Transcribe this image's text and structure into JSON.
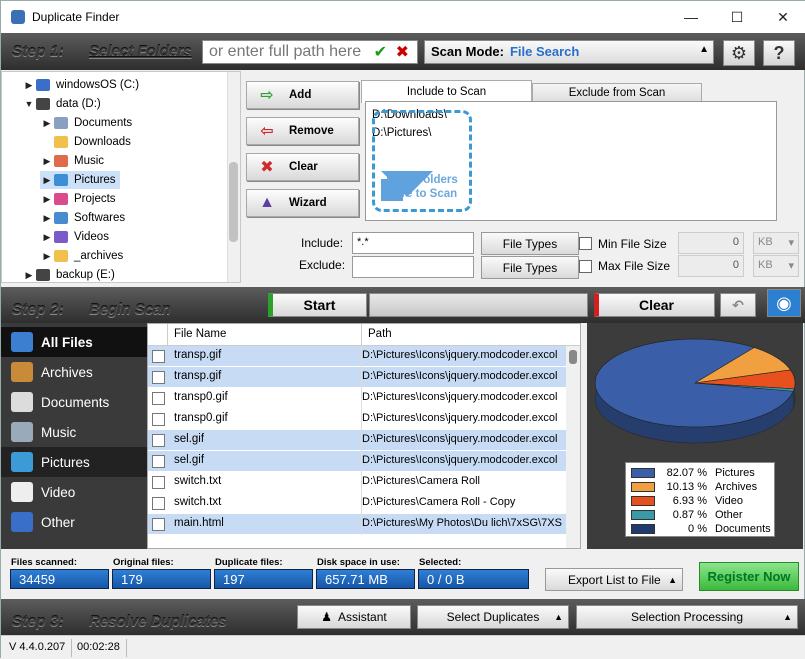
{
  "window": {
    "title": "Duplicate Finder",
    "minimize": "—",
    "maximize": "☐",
    "close": "✕"
  },
  "step1": {
    "label": "Step 1:",
    "sublabel": "Select Folders",
    "path_placeholder": "or enter full path here",
    "scan_mode_label": "Scan Mode:",
    "scan_mode_value": "File Search",
    "settings_icon": "gear-icon",
    "help_label": "?"
  },
  "tree": [
    {
      "label": "windowsOS (C:)",
      "expander": "▶",
      "icon": "drive-icon",
      "color": "#3a6fc9"
    },
    {
      "label": "data (D:)",
      "expander": "▼",
      "icon": "drive-icon",
      "color": "#444"
    },
    {
      "label": "Documents",
      "expander": "▶",
      "icon": "documents-folder-icon",
      "color": "#8aa0c0"
    },
    {
      "label": "Downloads",
      "expander": "",
      "icon": "folder-icon",
      "color": "#f1c04c"
    },
    {
      "label": "Music",
      "expander": "▶",
      "icon": "music-folder-icon",
      "color": "#e06b4a"
    },
    {
      "label": "Pictures",
      "expander": "▶",
      "icon": "pictures-folder-icon",
      "color": "#3c8fd6"
    },
    {
      "label": "Projects",
      "expander": "▶",
      "icon": "projects-folder-icon",
      "color": "#d94b8a"
    },
    {
      "label": "Softwares",
      "expander": "▶",
      "icon": "softwares-folder-icon",
      "color": "#4a8ad0"
    },
    {
      "label": "Videos",
      "expander": "▶",
      "icon": "videos-folder-icon",
      "color": "#7b5ac9"
    },
    {
      "label": "_archives",
      "expander": "▶",
      "icon": "folder-icon",
      "color": "#f1c04c"
    },
    {
      "label": "backup (E:)",
      "expander": "▶",
      "icon": "drive-icon",
      "color": "#444"
    }
  ],
  "actions": {
    "add": "Add",
    "remove": "Remove",
    "clear": "Clear",
    "wizard": "Wizard"
  },
  "tabs": {
    "include": "Include to Scan",
    "exclude": "Exclude from Scan"
  },
  "include_list": [
    "D:\\Downloads\\",
    "D:\\Pictures\\"
  ],
  "drop_area": {
    "line1": "Drop Folders",
    "line2": "Here to Scan"
  },
  "filters": {
    "include_label": "Include:",
    "include_value": "*.*",
    "exclude_label": "Exclude:",
    "exclude_value": "",
    "file_types": "File Types",
    "min_size_label": "Min File Size",
    "max_size_label": "Max File Size",
    "min_size_value": "0",
    "max_size_value": "0",
    "unit": "KB"
  },
  "step2": {
    "label": "Step 2:",
    "sublabel": "Begin Scan",
    "start": "Start",
    "clear": "Clear"
  },
  "categories": [
    {
      "label": "All Files",
      "icon": "all-files-icon",
      "color": "#3c7ed0"
    },
    {
      "label": "Archives",
      "icon": "archives-icon",
      "color": "#c98a3a"
    },
    {
      "label": "Documents",
      "icon": "documents-icon",
      "color": "#dcdcdc"
    },
    {
      "label": "Music",
      "icon": "music-icon",
      "color": "#9ab"
    },
    {
      "label": "Pictures",
      "icon": "pictures-icon",
      "color": "#3c9ad6"
    },
    {
      "label": "Video",
      "icon": "video-icon",
      "color": "#eee"
    },
    {
      "label": "Other",
      "icon": "other-icon",
      "color": "#3a6fc9"
    }
  ],
  "table": {
    "columns": [
      "File Name",
      "Path"
    ],
    "rows": [
      {
        "name": "transp.gif",
        "path": "D:\\Pictures\\Icons\\jquery.modcoder.excol",
        "selected": true
      },
      {
        "name": "transp.gif",
        "path": "D:\\Pictures\\Icons\\jquery.modcoder.excol",
        "selected": true
      },
      {
        "name": "transp0.gif",
        "path": "D:\\Pictures\\Icons\\jquery.modcoder.excol",
        "selected": false
      },
      {
        "name": "transp0.gif",
        "path": "D:\\Pictures\\Icons\\jquery.modcoder.excol",
        "selected": false
      },
      {
        "name": "sel.gif",
        "path": "D:\\Pictures\\Icons\\jquery.modcoder.excol",
        "selected": true
      },
      {
        "name": "sel.gif",
        "path": "D:\\Pictures\\Icons\\jquery.modcoder.excol",
        "selected": true
      },
      {
        "name": "switch.txt",
        "path": "D:\\Pictures\\Camera Roll",
        "selected": false
      },
      {
        "name": "switch.txt",
        "path": "D:\\Pictures\\Camera Roll - Copy",
        "selected": false
      },
      {
        "name": "main.html",
        "path": "D:\\Pictures\\My Photos\\Du lich\\7xSG\\7XS",
        "selected": true
      }
    ]
  },
  "chart_data": {
    "type": "pie",
    "categories": [
      "Pictures",
      "Archives",
      "Video",
      "Other",
      "Documents"
    ],
    "values": [
      82.07,
      10.13,
      6.93,
      0.87,
      0
    ],
    "labels": [
      "82.07 %",
      "10.13 %",
      "6.93 %",
      "0.87 %",
      "0 %"
    ],
    "colors": [
      "#3a5fa8",
      "#f0a040",
      "#e8501e",
      "#3b9aa8",
      "#1f3a6e"
    ],
    "legend": "bottom-center"
  },
  "stats": {
    "scanned_label": "Files scanned:",
    "scanned": "34459",
    "original_label": "Original files:",
    "original": "179",
    "duplicate_label": "Duplicate files:",
    "duplicate": "197",
    "disk_label": "Disk space in use:",
    "disk": "657.71 MB",
    "selected_label": "Selected:",
    "selected": "0 / 0 B",
    "export": "Export List to File",
    "register": "Register Now"
  },
  "step3": {
    "label": "Step 3:",
    "sublabel": "Resolve Duplicates",
    "assistant": "Assistant",
    "select_dups": "Select Duplicates",
    "sel_processing": "Selection Processing"
  },
  "status": {
    "version": "V 4.4.0.207",
    "time": "00:02:28"
  }
}
